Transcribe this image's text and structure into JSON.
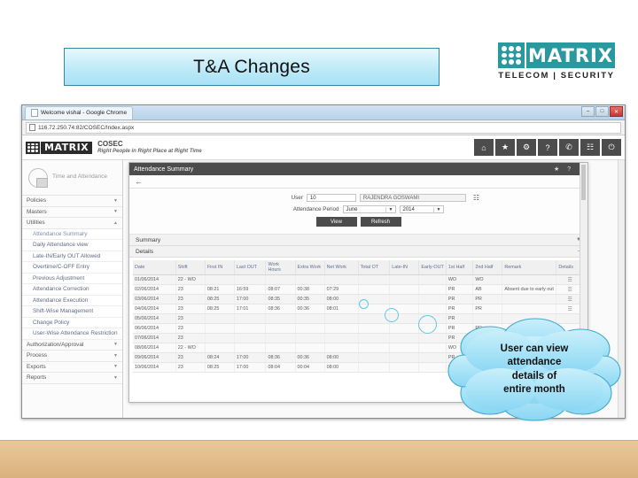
{
  "slide": {
    "title": "T&A Changes",
    "logo": {
      "word": "MATRIX",
      "tagline": "TELECOM | SECURITY",
      "color": "#2a999f"
    }
  },
  "browser": {
    "tab_title": "Welcome vishal - Google Chrome",
    "url": "116.72.250.74:82/COSEC/Index.aspx",
    "window_controls": [
      {
        "name": "minimize",
        "glyph": "–"
      },
      {
        "name": "maximize",
        "glyph": "□"
      },
      {
        "name": "close",
        "glyph": "✕"
      }
    ]
  },
  "app": {
    "logo_word": "MATRIX",
    "product": "COSEC",
    "tagline": "Right People in Right Place at Right Time",
    "toolbar": [
      {
        "name": "home-icon",
        "glyph": "⌂"
      },
      {
        "name": "star-icon",
        "glyph": "★"
      },
      {
        "name": "gear-icon",
        "glyph": "⚙"
      },
      {
        "name": "help-icon",
        "glyph": "?"
      },
      {
        "name": "phone-icon",
        "glyph": "✆"
      },
      {
        "name": "apps-icon",
        "glyph": "☷"
      },
      {
        "name": "power-icon",
        "glyph": "⏻"
      }
    ]
  },
  "sidebar": {
    "module": "Time and Attendance",
    "module_icon": "clock-calendar-icon",
    "groups": [
      {
        "label": "Policies",
        "expanded": false
      },
      {
        "label": "Masters",
        "expanded": false
      },
      {
        "label": "Utilities",
        "expanded": true
      }
    ],
    "items": [
      "Attendance Summary",
      "Daily Attendance view",
      "Late-IN/Early OUT Allowed",
      "Overtime/C-OFF Entry",
      "Previous Adjustment",
      "Attendance Correction",
      "Attendance Execution",
      "Shift-Wise Management",
      "Change Policy",
      "User-Wise Attendance Restriction"
    ],
    "groups_after": [
      {
        "label": "Authorization/Approval",
        "expanded": false
      },
      {
        "label": "Process",
        "expanded": false
      },
      {
        "label": "Exports",
        "expanded": false
      },
      {
        "label": "Reports",
        "expanded": false
      }
    ]
  },
  "dialog": {
    "title": "Attendance Summary",
    "title_actions": [
      {
        "name": "favorite-icon",
        "glyph": "★"
      },
      {
        "name": "help-icon",
        "glyph": "?"
      },
      {
        "name": "close-icon",
        "glyph": "✕"
      }
    ],
    "back_icon": "←",
    "filters": {
      "user_label": "User",
      "user_id": "10",
      "user_name": "RAJENDRA GOSWAMI",
      "picker_icon": "Ὕ0",
      "period_label": "Attendance Period",
      "period_month": "June",
      "period_year": "2014",
      "view_button": "View",
      "refresh_button": "Refresh"
    },
    "sections": [
      {
        "label": "Summary",
        "expanded": false
      },
      {
        "label": "Details",
        "expanded": true
      }
    ],
    "table": {
      "columns": [
        "Date",
        "Shift",
        "First IN",
        "Last OUT",
        "Work Hours",
        "Extra Work",
        "Net Work",
        "Total OT",
        "Late-IN",
        "Early-OUT",
        "1st Half",
        "2nd Half",
        "Remark",
        "Details"
      ],
      "rows": [
        [
          "01/06/2014",
          "22 - WO",
          "",
          "",
          "",
          "",
          "",
          "",
          "",
          "",
          "WO",
          "WO",
          "",
          "☰"
        ],
        [
          "02/06/2014",
          "23",
          "08:21",
          "16:59",
          "08:07",
          "00:38",
          "07:29",
          "",
          "",
          "",
          "PR",
          "AB",
          "Absent due to early out",
          "☰"
        ],
        [
          "03/06/2014",
          "23",
          "08:25",
          "17:00",
          "08:35",
          "00:35",
          "08:00",
          "",
          "",
          "",
          "PR",
          "PR",
          "",
          "☰"
        ],
        [
          "04/06/2014",
          "23",
          "08:25",
          "17:01",
          "08:36",
          "00:36",
          "08:01",
          "",
          "",
          "",
          "PR",
          "PR",
          "",
          "☰"
        ],
        [
          "05/06/2014",
          "23",
          "",
          "",
          "",
          "",
          "",
          "",
          "",
          "",
          "PR",
          "",
          "",
          ""
        ],
        [
          "06/06/2014",
          "23",
          "",
          "",
          "",
          "",
          "",
          "",
          "",
          "",
          "PR",
          "PR",
          "",
          ""
        ],
        [
          "07/06/2014",
          "23",
          "",
          "",
          "",
          "",
          "",
          "",
          "",
          "",
          "PR",
          "PR",
          "",
          ""
        ],
        [
          "08/06/2014",
          "22 - WO",
          "",
          "",
          "",
          "",
          "",
          "",
          "",
          "",
          "WO",
          "WO",
          "",
          ""
        ],
        [
          "09/06/2014",
          "23",
          "08:24",
          "17:00",
          "08:36",
          "00:36",
          "08:00",
          "",
          "",
          "",
          "PR",
          "PR",
          "",
          ""
        ],
        [
          "10/06/2014",
          "23",
          "08:25",
          "17:00",
          "08:04",
          "00:04",
          "08:00",
          "",
          "",
          "",
          "PR",
          "PR",
          "",
          ""
        ]
      ]
    }
  },
  "callout": {
    "lines": [
      "User can view",
      "attendance",
      "details of",
      "entire month"
    ],
    "fill": "#a8e3f7",
    "stroke": "#3fa9c9"
  }
}
